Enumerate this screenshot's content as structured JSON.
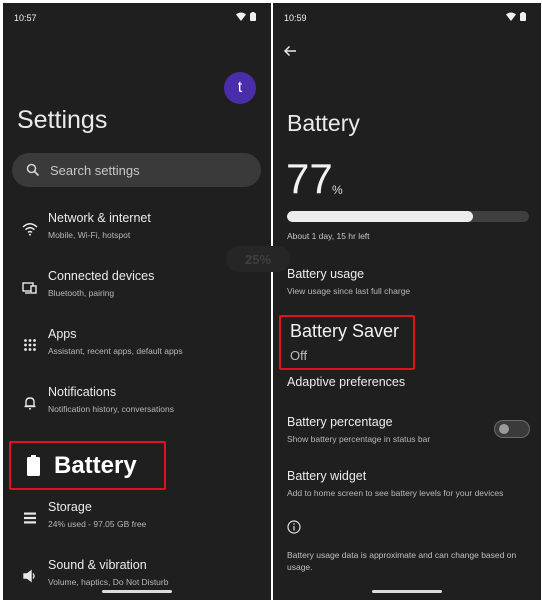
{
  "left": {
    "status": {
      "time": "10:57"
    },
    "avatar": {
      "initial": "t"
    },
    "title": "Settings",
    "search": {
      "placeholder": "Search settings"
    },
    "items": [
      {
        "title": "Network & internet",
        "subtitle": "Mobile, Wi-Fi, hotspot",
        "icon": "wifi-icon"
      },
      {
        "title": "Connected devices",
        "subtitle": "Bluetooth, pairing",
        "icon": "devices-icon"
      },
      {
        "title": "Apps",
        "subtitle": "Assistant, recent apps, default apps",
        "icon": "apps-grid-icon"
      },
      {
        "title": "Notifications",
        "subtitle": "Notification history, conversations",
        "icon": "bell-icon"
      },
      {
        "title": "Battery",
        "subtitle": "",
        "icon": "battery-icon",
        "highlighted": true
      },
      {
        "title": "Storage",
        "subtitle": "24% used - 97.05 GB free",
        "icon": "storage-icon"
      },
      {
        "title": "Sound & vibration",
        "subtitle": "Volume, haptics, Do Not Disturb",
        "icon": "volume-icon"
      }
    ]
  },
  "watermark": "25%",
  "right": {
    "status": {
      "time": "10:59"
    },
    "title": "Battery",
    "level": {
      "value": "77",
      "unit": "%",
      "fraction": 0.77
    },
    "remaining": "About 1 day, 15 hr left",
    "usage": {
      "title": "Battery usage",
      "subtitle": "View usage since last full charge"
    },
    "saver": {
      "title": "Battery Saver",
      "status": "Off"
    },
    "adaptive": {
      "title": "Adaptive preferences"
    },
    "percentage": {
      "title": "Battery percentage",
      "subtitle": "Show battery percentage in status bar",
      "enabled": false
    },
    "widget": {
      "title": "Battery widget",
      "subtitle": "Add to home screen to see battery levels for your devices"
    },
    "footer": "Battery usage data is approximate and can change based on usage."
  },
  "colors": {
    "background": "#1f1f1f",
    "highlight": "#e0131b",
    "avatar": "#4a2dab"
  }
}
